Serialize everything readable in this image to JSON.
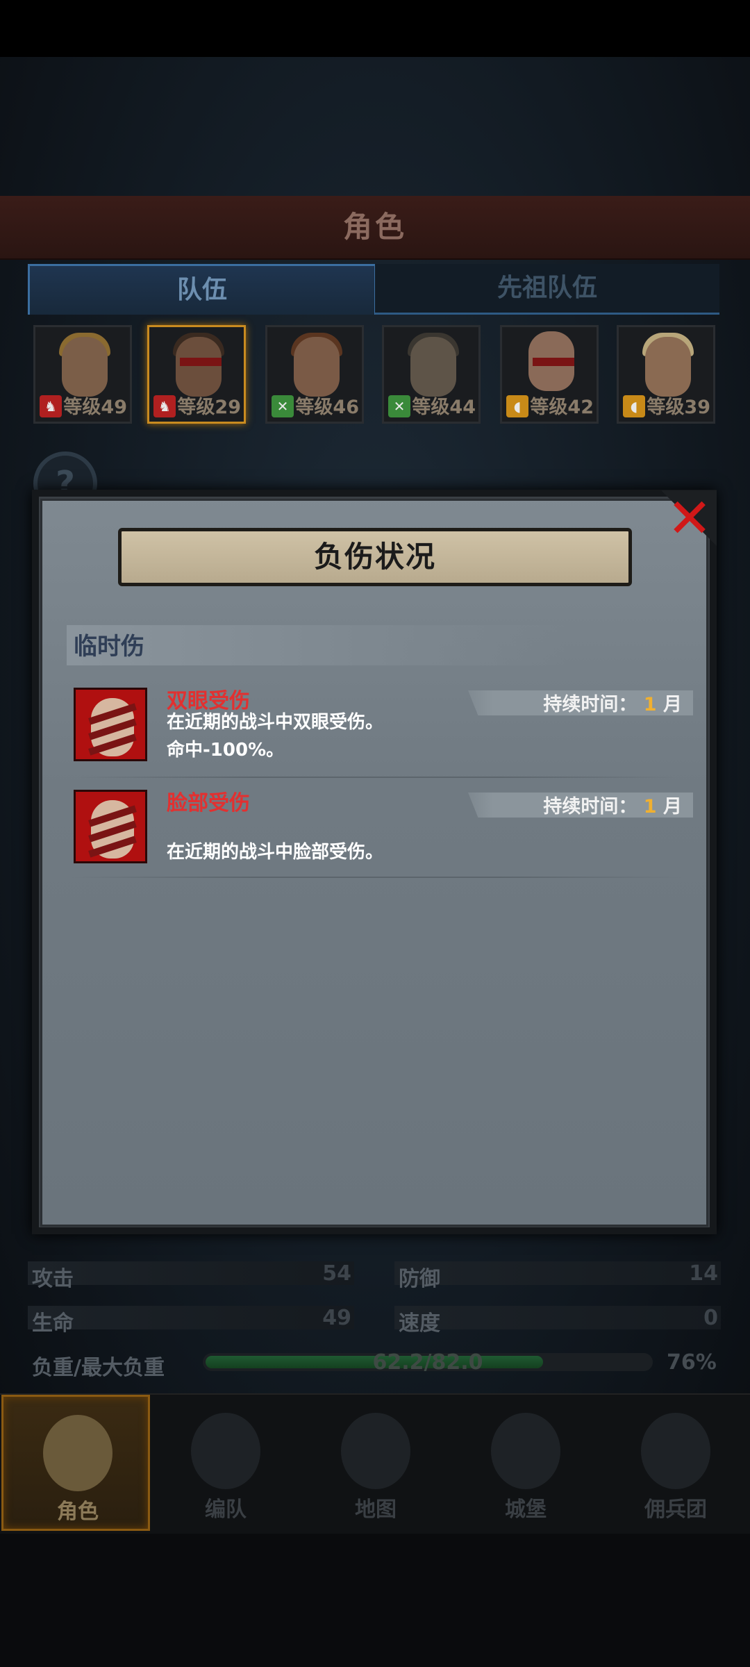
{
  "screen": {
    "title": "角色"
  },
  "tabs": [
    {
      "label": "队伍",
      "active": true
    },
    {
      "label": "先祖队伍",
      "active": false
    }
  ],
  "portraits": [
    {
      "level": "等级49",
      "class_icon": "horse-icon",
      "class_color": "#b02020"
    },
    {
      "level": "等级29",
      "class_icon": "horse-icon",
      "class_color": "#b02020",
      "selected": true
    },
    {
      "level": "等级46",
      "class_icon": "crossed-swords-icon",
      "class_color": "#3a8a3a"
    },
    {
      "level": "等级44",
      "class_icon": "crossed-swords-icon",
      "class_color": "#3a8a3a"
    },
    {
      "level": "等级42",
      "class_icon": "shield-icon",
      "class_color": "#c88a18"
    },
    {
      "level": "等级39",
      "class_icon": "shield-icon",
      "class_color": "#c88a18"
    }
  ],
  "modal": {
    "title": "负伤状况",
    "section_title": "临时伤",
    "injuries": [
      {
        "name": "双眼受伤",
        "duration_label": "持续时间：",
        "duration_value": "1",
        "duration_unit": "月",
        "desc_line1": "在近期的战斗中双眼受伤。",
        "desc_line2": "命中-100%。"
      },
      {
        "name": "脸部受伤",
        "duration_label": "持续时间：",
        "duration_value": "1",
        "duration_unit": "月",
        "desc_line1": "",
        "desc_line2": "在近期的战斗中脸部受伤。"
      }
    ]
  },
  "stats": {
    "attack_label": "攻击",
    "attack_value": "54",
    "defense_label": "防御",
    "defense_value": "14",
    "hp_label": "生命",
    "hp_value": "49",
    "speed_label": "速度",
    "speed_value": "0",
    "load_label": "负重/最大负重",
    "load_text": "62.2/82.0",
    "load_percent": "76%",
    "load_fraction": 0.76
  },
  "nav": [
    {
      "label": "角色",
      "icon": "knight-icon",
      "active": true
    },
    {
      "label": "编队",
      "icon": "helmet-icon",
      "active": false
    },
    {
      "label": "地图",
      "icon": "compass-map-icon",
      "active": false
    },
    {
      "label": "城堡",
      "icon": "castle-icon",
      "active": false
    },
    {
      "label": "佣兵团",
      "icon": "mercenary-banner-icon",
      "active": false
    }
  ]
}
